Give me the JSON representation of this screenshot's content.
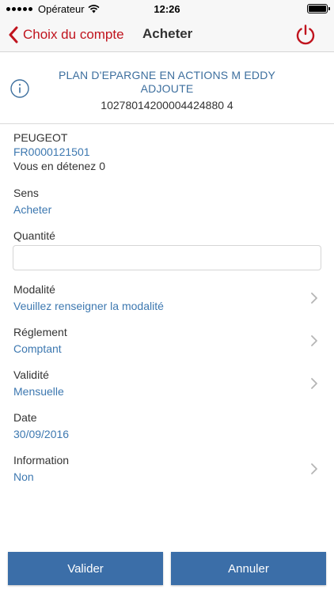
{
  "status_bar": {
    "carrier": "Opérateur",
    "time": "12:26"
  },
  "nav": {
    "back_label": "Choix du compte",
    "title": "Acheter",
    "accent_color": "#c0141e"
  },
  "account": {
    "name": "PLAN D'EPARGNE EN ACTIONS M EDDY ADJOUTE",
    "number": "10278014200004424880 4"
  },
  "security": {
    "name": "PEUGEOT",
    "isin": "FR0000121501",
    "holding": "Vous en détenez 0"
  },
  "fields": {
    "sens": {
      "label": "Sens",
      "value": "Acheter"
    },
    "quantite": {
      "label": "Quantité",
      "value": "",
      "placeholder": ""
    },
    "modalite": {
      "label": "Modalité",
      "value": "Veuillez renseigner la modalité"
    },
    "reglement": {
      "label": "Réglement",
      "value": "Comptant"
    },
    "validite": {
      "label": "Validité",
      "value": "Mensuelle"
    },
    "date": {
      "label": "Date",
      "value": "30/09/2016"
    },
    "information": {
      "label": "Information",
      "value": "Non"
    }
  },
  "buttons": {
    "validate": "Valider",
    "cancel": "Annuler",
    "color": "#3b6ea8"
  },
  "icons": {
    "back": "chevron-left-icon",
    "power": "power-icon",
    "info": "info-icon",
    "disclosure": "chevron-right-icon"
  }
}
